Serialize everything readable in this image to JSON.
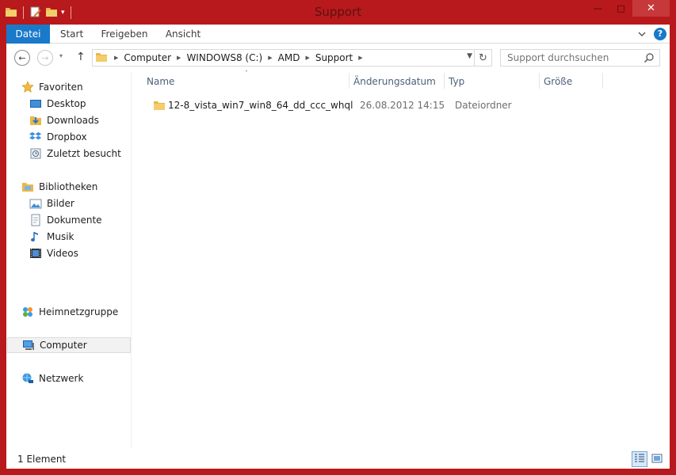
{
  "window": {
    "title": "Support",
    "colors": {
      "frame": "#b8191c",
      "accent": "#1979ca",
      "folder": "#e8b84a"
    }
  },
  "caption_buttons": {
    "minimize": "—",
    "maximize": "□",
    "close": "✕"
  },
  "ribbon": {
    "tabs": [
      {
        "label": "Datei",
        "active": true
      },
      {
        "label": "Start"
      },
      {
        "label": "Freigeben"
      },
      {
        "label": "Ansicht"
      }
    ],
    "expand_icon": "chevron-down-icon",
    "help_label": "?"
  },
  "navigation": {
    "back_glyph": "←",
    "forward_glyph": "→",
    "up_glyph": "↑",
    "breadcrumb": [
      "Computer",
      "WINDOWS8 (C:)",
      "AMD",
      "Support"
    ],
    "search_placeholder": "Support durchsuchen"
  },
  "sidebar": {
    "groups": [
      {
        "label": "Favoriten",
        "icon": "star-icon",
        "items": [
          {
            "label": "Desktop",
            "icon": "desktop-icon"
          },
          {
            "label": "Downloads",
            "icon": "downloads-icon"
          },
          {
            "label": "Dropbox",
            "icon": "dropbox-icon"
          },
          {
            "label": "Zuletzt besucht",
            "icon": "recent-places-icon"
          }
        ]
      },
      {
        "label": "Bibliotheken",
        "icon": "libraries-icon",
        "items": [
          {
            "label": "Bilder",
            "icon": "pictures-icon"
          },
          {
            "label": "Dokumente",
            "icon": "documents-icon"
          },
          {
            "label": "Musik",
            "icon": "music-icon"
          },
          {
            "label": "Videos",
            "icon": "videos-icon"
          }
        ]
      },
      {
        "label": "Heimnetzgruppe",
        "icon": "homegroup-icon"
      },
      {
        "label": "Computer",
        "icon": "computer-icon",
        "selected": true
      },
      {
        "label": "Netzwerk",
        "icon": "network-icon"
      }
    ]
  },
  "file_list": {
    "columns": [
      "Name",
      "Änderungsdatum",
      "Typ",
      "Größe"
    ],
    "sort_indicator": "˄",
    "rows": [
      {
        "name": "12-8_vista_win7_win8_64_dd_ccc_whql",
        "date": "26.08.2012 14:15",
        "type": "Dateiordner",
        "size": ""
      }
    ]
  },
  "status": {
    "text": "1 Element"
  }
}
